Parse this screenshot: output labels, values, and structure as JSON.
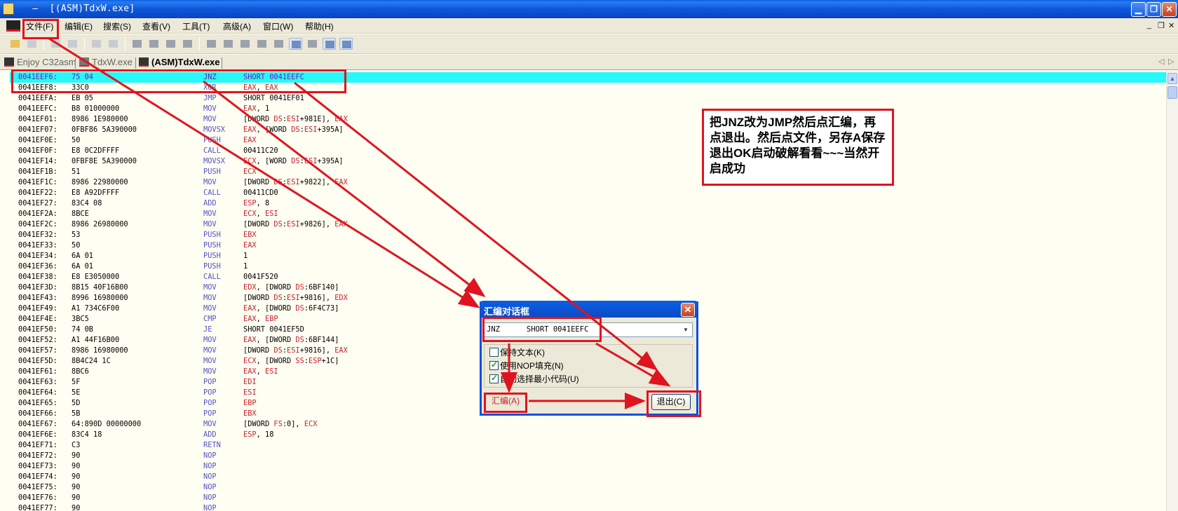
{
  "window": {
    "title": "  —  [(ASM)TdxW.exe]",
    "minimize": "▁",
    "restore": "❐",
    "close": "✕"
  },
  "menu": {
    "items": [
      "文件(F)",
      "编辑(E)",
      "搜索(S)",
      "查看(V)",
      "工具(T)",
      "高级(A)",
      "窗口(W)",
      "帮助(H)"
    ],
    "mdi_min": "_",
    "mdi_restore": "❐",
    "mdi_close": "✕"
  },
  "tabs": {
    "items": [
      {
        "label": "Enjoy C32asm",
        "active": false
      },
      {
        "label": "TdxW.exe",
        "active": false
      },
      {
        "label": "(ASM)TdxW.exe",
        "active": true
      }
    ],
    "nav_left": "◁",
    "nav_right": "▷"
  },
  "code": {
    "rows": [
      {
        "addr": "0041EEF6:",
        "bytes": "75 04",
        "mn": "JNZ",
        "op": "SHORT 0041EEFC"
      },
      {
        "addr": "0041EEF8:",
        "bytes": "33C0",
        "mn": "XOR",
        "op": "EAX, EAX"
      },
      {
        "addr": "0041EEFA:",
        "bytes": "EB 05",
        "mn": "JMP",
        "op": "SHORT 0041EF01"
      },
      {
        "addr": "0041EEFC:",
        "bytes": "B8 01000000",
        "mn": "MOV",
        "op": "EAX, 1"
      },
      {
        "addr": "0041EF01:",
        "bytes": "8986 1E980000",
        "mn": "MOV",
        "op": "[DWORD DS:ESI+981E], EAX"
      },
      {
        "addr": "0041EF07:",
        "bytes": "0FBF86 5A390000",
        "mn": "MOVSX",
        "op": "EAX, [WORD DS:ESI+395A]"
      },
      {
        "addr": "0041EF0E:",
        "bytes": "50",
        "mn": "PUSH",
        "op": "EAX"
      },
      {
        "addr": "0041EF0F:",
        "bytes": "E8 0C2DFFFF",
        "mn": "CALL",
        "op": "00411C20"
      },
      {
        "addr": "0041EF14:",
        "bytes": "0FBF8E 5A390000",
        "mn": "MOVSX",
        "op": "ECX, [WORD DS:ESI+395A]"
      },
      {
        "addr": "0041EF1B:",
        "bytes": "51",
        "mn": "PUSH",
        "op": "ECX"
      },
      {
        "addr": "0041EF1C:",
        "bytes": "8986 22980000",
        "mn": "MOV",
        "op": "[DWORD DS:ESI+9822], EAX"
      },
      {
        "addr": "0041EF22:",
        "bytes": "E8 A92DFFFF",
        "mn": "CALL",
        "op": "00411CD0"
      },
      {
        "addr": "0041EF27:",
        "bytes": "83C4 08",
        "mn": "ADD",
        "op": "ESP, 8"
      },
      {
        "addr": "0041EF2A:",
        "bytes": "8BCE",
        "mn": "MOV",
        "op": "ECX, ESI"
      },
      {
        "addr": "0041EF2C:",
        "bytes": "8986 26980000",
        "mn": "MOV",
        "op": "[DWORD DS:ESI+9826], EAX"
      },
      {
        "addr": "0041EF32:",
        "bytes": "53",
        "mn": "PUSH",
        "op": "EBX"
      },
      {
        "addr": "0041EF33:",
        "bytes": "50",
        "mn": "PUSH",
        "op": "EAX"
      },
      {
        "addr": "0041EF34:",
        "bytes": "6A 01",
        "mn": "PUSH",
        "op": "1"
      },
      {
        "addr": "0041EF36:",
        "bytes": "6A 01",
        "mn": "PUSH",
        "op": "1"
      },
      {
        "addr": "0041EF38:",
        "bytes": "E8 E3050000",
        "mn": "CALL",
        "op": "0041F520"
      },
      {
        "addr": "0041EF3D:",
        "bytes": "8B15 40F16B00",
        "mn": "MOV",
        "op": "EDX, [DWORD DS:6BF140]"
      },
      {
        "addr": "0041EF43:",
        "bytes": "8996 16980000",
        "mn": "MOV",
        "op": "[DWORD DS:ESI+9816], EDX"
      },
      {
        "addr": "0041EF49:",
        "bytes": "A1 734C6F00",
        "mn": "MOV",
        "op": "EAX, [DWORD DS:6F4C73]"
      },
      {
        "addr": "0041EF4E:",
        "bytes": "3BC5",
        "mn": "CMP",
        "op": "EAX, EBP"
      },
      {
        "addr": "0041EF50:",
        "bytes": "74 0B",
        "mn": "JE",
        "op": "SHORT 0041EF5D"
      },
      {
        "addr": "0041EF52:",
        "bytes": "A1 44F16B00",
        "mn": "MOV",
        "op": "EAX, [DWORD DS:6BF144]"
      },
      {
        "addr": "0041EF57:",
        "bytes": "8986 16980000",
        "mn": "MOV",
        "op": "[DWORD DS:ESI+9816], EAX"
      },
      {
        "addr": "0041EF5D:",
        "bytes": "8B4C24 1C",
        "mn": "MOV",
        "op": "ECX, [DWORD SS:ESP+1C]"
      },
      {
        "addr": "0041EF61:",
        "bytes": "8BC6",
        "mn": "MOV",
        "op": "EAX, ESI"
      },
      {
        "addr": "0041EF63:",
        "bytes": "5F",
        "mn": "POP",
        "op": "EDI"
      },
      {
        "addr": "0041EF64:",
        "bytes": "5E",
        "mn": "POP",
        "op": "ESI"
      },
      {
        "addr": "0041EF65:",
        "bytes": "5D",
        "mn": "POP",
        "op": "EBP"
      },
      {
        "addr": "0041EF66:",
        "bytes": "5B",
        "mn": "POP",
        "op": "EBX"
      },
      {
        "addr": "0041EF67:",
        "bytes": "64:890D 00000000",
        "mn": "MOV",
        "op": "[DWORD FS:0], ECX"
      },
      {
        "addr": "0041EF6E:",
        "bytes": "83C4 18",
        "mn": "ADD",
        "op": "ESP, 18"
      },
      {
        "addr": "0041EF71:",
        "bytes": "C3",
        "mn": "RETN",
        "op": ""
      },
      {
        "addr": "0041EF72:",
        "bytes": "90",
        "mn": "NOP",
        "op": ""
      },
      {
        "addr": "0041EF73:",
        "bytes": "90",
        "mn": "NOP",
        "op": ""
      },
      {
        "addr": "0041EF74:",
        "bytes": "90",
        "mn": "NOP",
        "op": ""
      },
      {
        "addr": "0041EF75:",
        "bytes": "90",
        "mn": "NOP",
        "op": ""
      },
      {
        "addr": "0041EF76:",
        "bytes": "90",
        "mn": "NOP",
        "op": ""
      },
      {
        "addr": "0041EF77:",
        "bytes": "90",
        "mn": "NOP",
        "op": ""
      }
    ]
  },
  "note": {
    "text": "把JNZ改为JMP然后点汇编，再点退出。然后点文件，另存A保存退出OK启动破解看看~~~当然开启成功"
  },
  "dialog": {
    "title": "汇编对话框",
    "combo_value": "JNZ      SHORT 0041EEFC",
    "options": [
      {
        "label": "保持文本(K)",
        "checked": false
      },
      {
        "label": "使用NOP填充(N)",
        "checked": true
      },
      {
        "label": "自动选择最小代码(U)",
        "checked": true
      }
    ],
    "assemble_label": "汇编(A)",
    "exit_label": "退出(C)"
  },
  "colors": {
    "highlight_row": "#28f8f8",
    "mnemonic": "#5252c8",
    "register": "#c8242a",
    "annotation_red": "#e0141e"
  }
}
